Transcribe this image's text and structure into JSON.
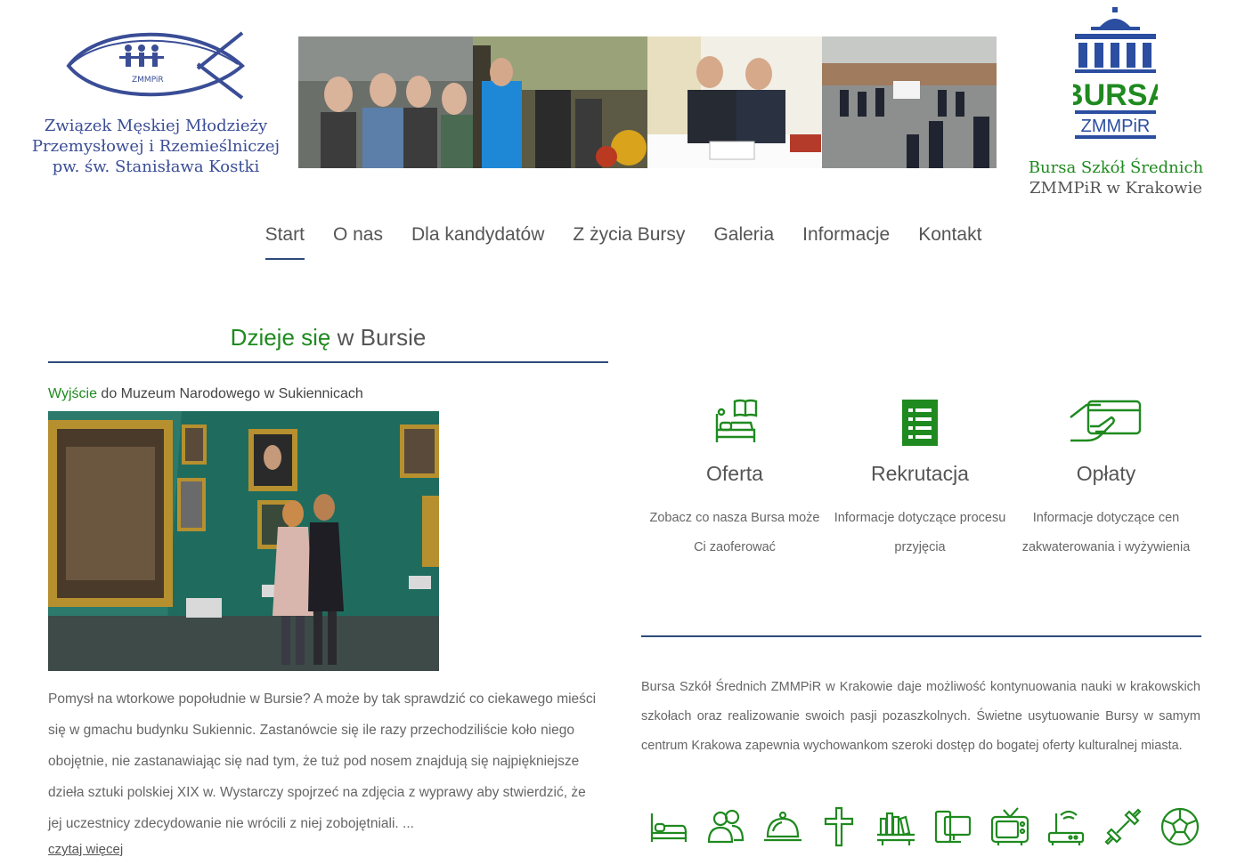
{
  "header": {
    "org_name_lines": [
      "Związek Męskiej Młodzieży",
      "Przemysłowej i Rzemieślniczej",
      "pw. św. Stanisława Kostki"
    ],
    "fish_logo_text": "ZMMPiR",
    "bursa_logo_word": "BURSA",
    "bursa_logo_sub": "ZMMPiR",
    "bursa_title_line1": "Bursa Szkół Średnich",
    "bursa_title_line2": "ZMMPiR w Krakowie"
  },
  "nav": {
    "items": [
      {
        "label": "Start",
        "active": true
      },
      {
        "label": "O nas",
        "active": false
      },
      {
        "label": "Dla kandydatów",
        "active": false
      },
      {
        "label": "Z życia Bursy",
        "active": false
      },
      {
        "label": "Galeria",
        "active": false
      },
      {
        "label": "Informacje",
        "active": false
      },
      {
        "label": "Kontakt",
        "active": false
      }
    ]
  },
  "news": {
    "heading_green": "Dzieje się",
    "heading_rest": "w Bursie",
    "article": {
      "title_green": "Wyjście",
      "title_rest": "do Muzeum Narodowego w Sukiennicach",
      "body": "Pomysł na wtorkowe popołudnie w Bursie? A może by tak sprawdzić co ciekawego mieści się w gmachu budynku Sukiennic. Zastanówcie się ile razy przechodziliście koło niego obojętnie, nie zastanawiając się nad tym, że tuż pod nosem znajdują się najpiękniejsze dzieła sztuki polskiej XIX w. Wystarczy spojrzeć na zdjęcia z wyprawy aby stwierdzić, że jej uczestnicy zdecydowanie nie wrócili z niej zobojętniali. ...",
      "read_more": "czytaj więcej"
    }
  },
  "cards": [
    {
      "icon": "bed-book-icon",
      "title": "Oferta",
      "desc": "Zobacz co nasza Bursa może Ci zaoferować"
    },
    {
      "icon": "document-list-icon",
      "title": "Rekrutacja",
      "desc": "Informacje dotyczące procesu przyjęcia"
    },
    {
      "icon": "payment-card-icon",
      "title": "Opłaty",
      "desc": "Informacje dotyczące cen zakwaterowania i wyżywienia"
    }
  ],
  "about": {
    "text": "Bursa Szkół Średnich ZMMPiR w Krakowie daje możliwość kontynuowania nauki w krakowskich szkołach oraz realizowanie swoich pasji pozaszkolnych. Świetne usytuowanie Bursy w samym centrum Krakowa zapewnia wychowankom szeroki dostęp do bogatej oferty kulturalnej miasta."
  },
  "amenities": [
    "bed-icon",
    "people-icon",
    "meal-cloche-icon",
    "cross-icon",
    "library-icon",
    "computer-icon",
    "tv-icon",
    "wifi-router-icon",
    "dumbbell-icon",
    "football-icon"
  ],
  "colors": {
    "green": "#1f8a1f",
    "navy": "#2e4a7a",
    "logo_blue": "#3a4d96"
  }
}
